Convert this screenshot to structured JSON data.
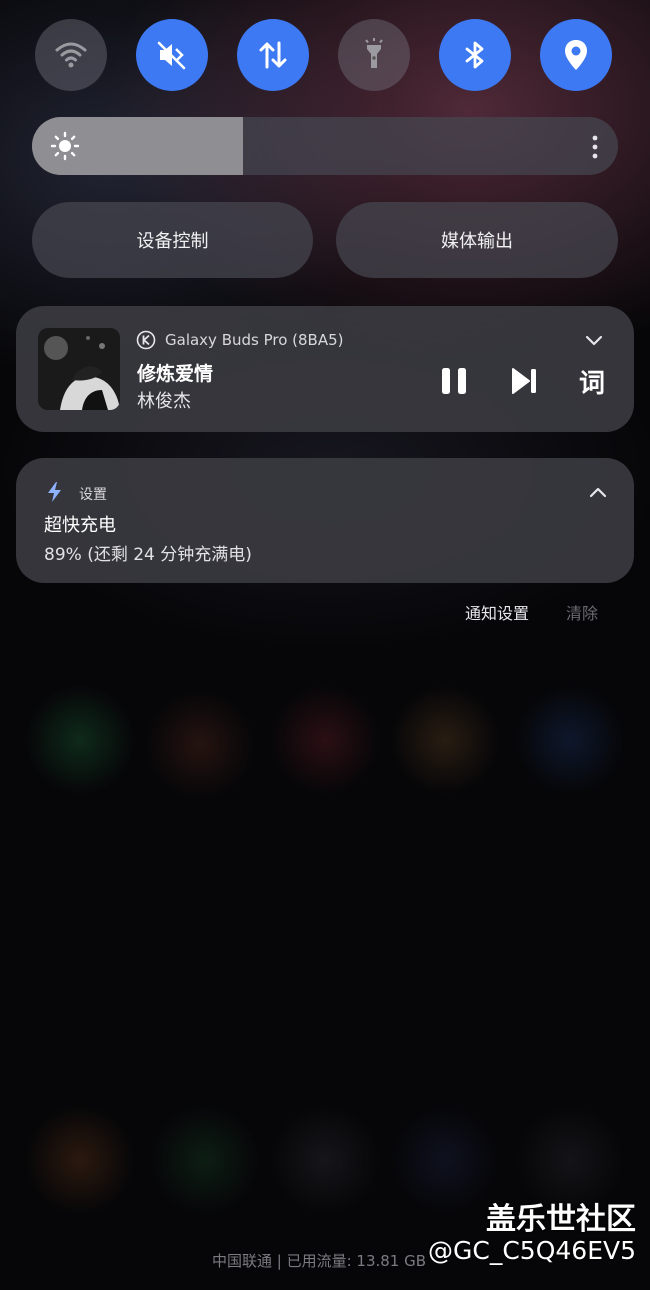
{
  "quick_settings": {
    "tiles": [
      {
        "name": "wifi-icon",
        "state": "off"
      },
      {
        "name": "mute-icon",
        "state": "on"
      },
      {
        "name": "mobile-data-icon",
        "state": "on"
      },
      {
        "name": "flashlight-icon",
        "state": "off"
      },
      {
        "name": "bluetooth-icon",
        "state": "on"
      },
      {
        "name": "location-icon",
        "state": "on"
      }
    ],
    "accent_color": "#3d79f2",
    "brightness_level": 0.36
  },
  "buttons": {
    "device_control": "设备控制",
    "media_output": "媒体输出"
  },
  "media": {
    "device": "Galaxy Buds Pro (8BA5)",
    "song": "修炼爱情",
    "artist": "林俊杰",
    "lyrics_label": "词"
  },
  "notification": {
    "app": "设置",
    "title": "超快充电",
    "body": "89% (还剩 24 分钟充满电)"
  },
  "notification_actions": {
    "settings": "通知设置",
    "clear": "清除"
  },
  "footer": {
    "carrier": "中国联通 | 已用流量: 13.81 GB"
  },
  "watermark": {
    "line1": "盖乐世社区",
    "line2": "@GC_C5Q46EV5"
  }
}
